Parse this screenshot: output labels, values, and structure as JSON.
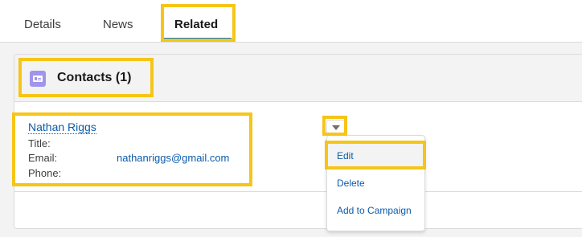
{
  "tabs": [
    {
      "label": "Details"
    },
    {
      "label": "News"
    },
    {
      "label": "Related"
    }
  ],
  "related": {
    "contacts_card": {
      "icon": "contact-card-icon",
      "title": "Contacts (1)"
    }
  },
  "contact": {
    "name": "Nathan Riggs",
    "fields": [
      {
        "label": "Title:",
        "value": ""
      },
      {
        "label": "Email:",
        "value": "nathanriggs@gmail.com"
      },
      {
        "label": "Phone:",
        "value": ""
      }
    ]
  },
  "row_actions_menu": {
    "trigger_icon": "chevron-down-icon",
    "items": [
      {
        "label": "Edit"
      },
      {
        "label": "Delete"
      },
      {
        "label": "Add to Campaign"
      }
    ]
  },
  "colors": {
    "highlight": "#f5c518",
    "link": "#0b5cab",
    "contact_icon": "#a094ed"
  }
}
